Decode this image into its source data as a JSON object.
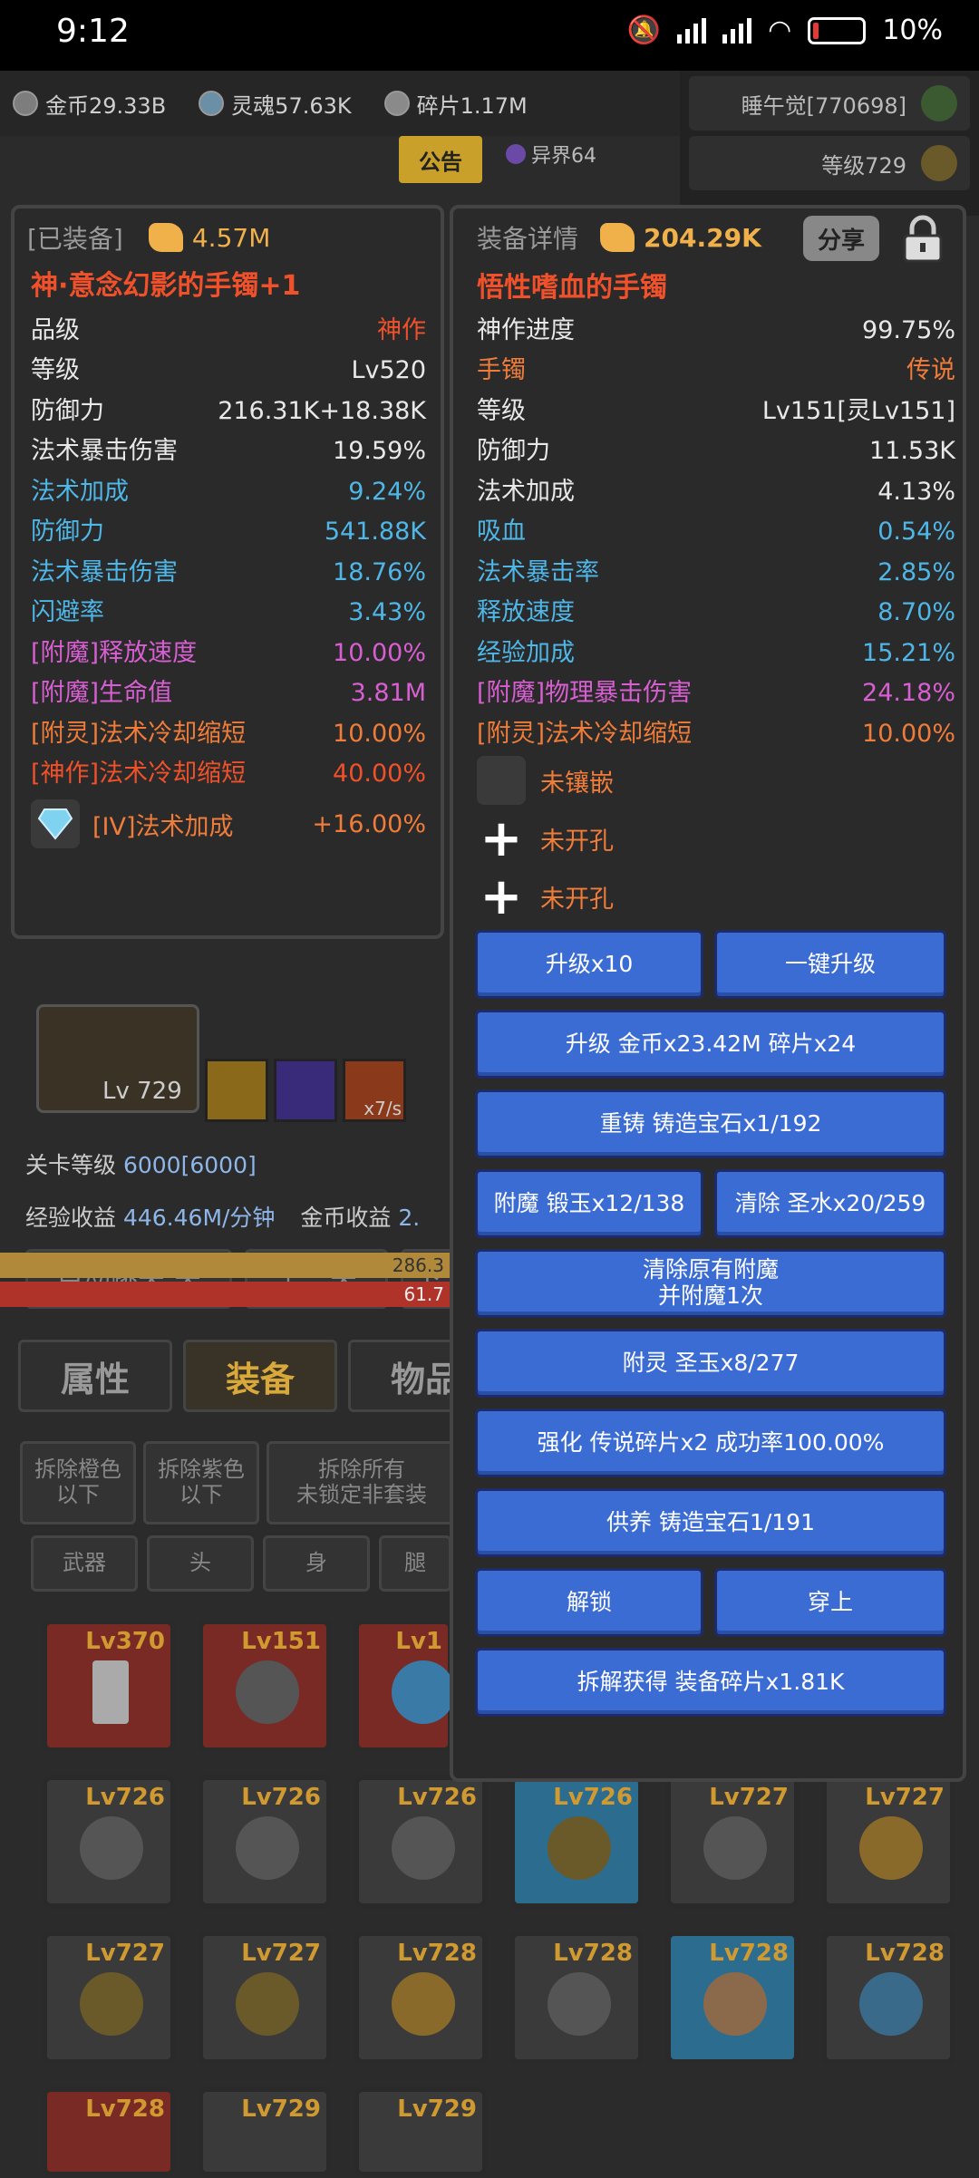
{
  "status": {
    "time": "9:12",
    "battery": "10%",
    "battery_level": 0.1
  },
  "resources": {
    "gold": "金币29.33B",
    "soul": "灵魂57.63K",
    "shards": "碎片1.17M"
  },
  "top_right": {
    "player": "睡午觉[770698]",
    "level": "等级729"
  },
  "notice": "公告",
  "otherworld": "异界64",
  "equipped": {
    "tag": "[已装备]",
    "power": "4.57M",
    "name": "神·意念幻影的手镯+1",
    "rows": [
      {
        "label": "品级",
        "value": "神作",
        "color": "red"
      },
      {
        "label": "等级",
        "value": "Lv520",
        "color": "w"
      },
      {
        "label": "防御力",
        "value": "216.31K+18.38K",
        "color": "w"
      },
      {
        "label": "法术暴击伤害",
        "value": "19.59%",
        "color": "w"
      },
      {
        "label": "法术加成",
        "value": "9.24%",
        "color": "blue"
      },
      {
        "label": "防御力",
        "value": "541.88K",
        "color": "blue"
      },
      {
        "label": "法术暴击伤害",
        "value": "18.76%",
        "color": "blue"
      },
      {
        "label": "闪避率",
        "value": "3.43%",
        "color": "blue"
      },
      {
        "label": "[附魔]释放速度",
        "value": "10.00%",
        "color": "pink"
      },
      {
        "label": "[附魔]生命值",
        "value": "3.81M",
        "color": "pink"
      },
      {
        "label": "[附灵]法术冷却缩短",
        "value": "10.00%",
        "color": "orange"
      },
      {
        "label": "[神作]法术冷却缩短",
        "value": "40.00%",
        "color": "red"
      }
    ],
    "gem_label": "[IV]法术加成",
    "gem_value": "+16.00%"
  },
  "detail": {
    "title": "装备详情",
    "power": "204.29K",
    "share": "分享",
    "name": "悟性嗜血的手镯",
    "rows": [
      {
        "label": "神作进度",
        "value": "99.75%",
        "color": "w"
      },
      {
        "label": "手镯",
        "value": "传说",
        "color": "orange"
      },
      {
        "label": "等级",
        "value": "Lv151[灵Lv151]",
        "color": "w"
      },
      {
        "label": "防御力",
        "value": "11.53K",
        "color": "w"
      },
      {
        "label": "法术加成",
        "value": "4.13%",
        "color": "w"
      },
      {
        "label": "吸血",
        "value": "0.54%",
        "color": "blue"
      },
      {
        "label": "法术暴击率",
        "value": "2.85%",
        "color": "blue"
      },
      {
        "label": "释放速度",
        "value": "8.70%",
        "color": "blue"
      },
      {
        "label": "经验加成",
        "value": "15.21%",
        "color": "blue"
      },
      {
        "label": "[附魔]物理暴击伤害",
        "value": "24.18%",
        "color": "pink"
      },
      {
        "label": "[附灵]法术冷却缩短",
        "value": "10.00%",
        "color": "orange"
      }
    ],
    "sockets": [
      "未镶嵌",
      "未开孔",
      "未开孔"
    ],
    "buttons": {
      "upgrade10": "升级x10",
      "one_click": "一键升级",
      "upgrade_cost": "升级 金币x23.42M 碎片x24",
      "recast": "重铸 铸造宝石x1/192",
      "enchant": "附魔 锻玉x12/138",
      "clear": "清除 圣水x20/259",
      "clear_enchant": "清除原有附魔",
      "clear_enchant2": "并附魔1次",
      "spirit": "附灵 圣玉x8/277",
      "strengthen": "强化 传说碎片x2 成功率100.00%",
      "nurture": "供养 铸造宝石1/191",
      "unlock": "解锁",
      "wear": "穿上",
      "dismantle": "拆解获得 装备碎片x1.81K"
    }
  },
  "stage": {
    "hero_level": "Lv 729",
    "speed": "x7/s",
    "stage_label": "关卡等级",
    "stage_value": "6000[6000]",
    "exp_label": "经验收益",
    "exp_value": "446.46M/分钟",
    "gold_label": "金币收益",
    "gold_value": "2.",
    "auto_skip": "自动跳关:关",
    "prev": "上一关",
    "next": "下",
    "bar1": "286.3",
    "bar2": "61.7"
  },
  "tabs": [
    "属性",
    "装备",
    "物品"
  ],
  "filters": {
    "orange": "拆除橙色",
    "orange2": "以下",
    "purple": "拆除紫色",
    "purple2": "以下",
    "all": "拆除所有",
    "all2": "未锁定非套装"
  },
  "slots": [
    "武器",
    "头",
    "身",
    "腿"
  ],
  "items_row1": [
    "Lv370",
    "Lv151",
    "Lv1"
  ],
  "items_row2": [
    "Lv726",
    "Lv726",
    "Lv726",
    "Lv726",
    "Lv727",
    "Lv727"
  ],
  "items_row3": [
    "Lv727",
    "Lv727",
    "Lv728",
    "Lv728",
    "Lv728",
    "Lv728"
  ],
  "items_row4": [
    "Lv728",
    "Lv729",
    "Lv729"
  ]
}
